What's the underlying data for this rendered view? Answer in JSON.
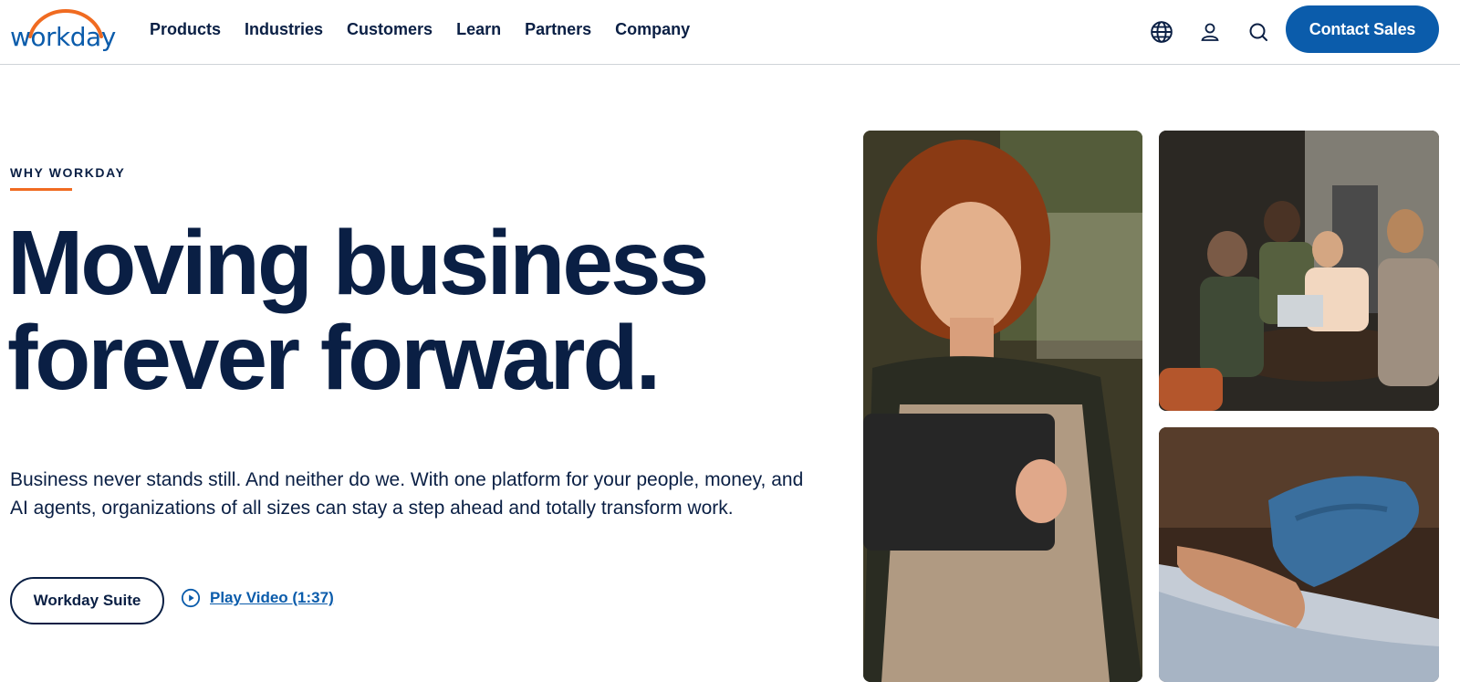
{
  "brand": {
    "logo_text": "workday",
    "logo_icon": "workday-arc-logo",
    "primary_color": "#0b5cab",
    "accent_color": "#f06b21",
    "text_color": "#0a1f44"
  },
  "nav": {
    "items": [
      {
        "label": "Products"
      },
      {
        "label": "Industries"
      },
      {
        "label": "Customers"
      },
      {
        "label": "Learn"
      },
      {
        "label": "Partners"
      },
      {
        "label": "Company"
      }
    ],
    "icons": [
      "globe-icon",
      "user-icon",
      "search-icon"
    ],
    "contact_label": "Contact Sales"
  },
  "hero": {
    "eyebrow": "WHY WORKDAY",
    "headline_line1": "Moving business",
    "headline_line2": "forever forward.",
    "body": "Business never stands still. And neither do we. With one platform for your people, money, and AI agents, organizations of all sizes can stay a step ahead and totally transform work.",
    "primary_button": "Workday Suite",
    "video_link": "Play Video (1:37)"
  },
  "images": [
    {
      "name": "woman-with-tablet-photo"
    },
    {
      "name": "team-meeting-photo"
    },
    {
      "name": "gloved-hand-holding-hand-photo"
    }
  ]
}
